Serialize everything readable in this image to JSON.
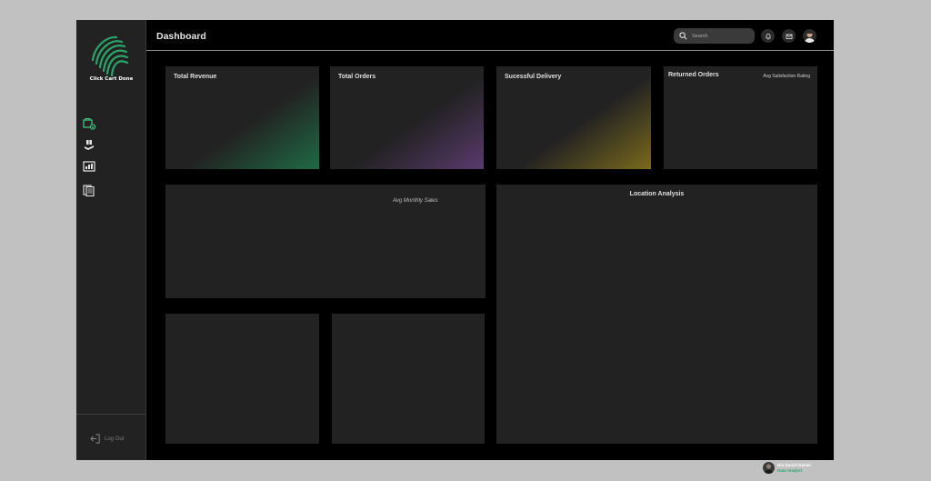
{
  "brand": {
    "name": "Click Cart Done",
    "accent": "#2aa56a"
  },
  "sidebar": {
    "items": [
      {
        "name": "orders-nav",
        "icon": "cart-check-icon"
      },
      {
        "name": "delivery-nav",
        "icon": "delivery-hand-icon"
      },
      {
        "name": "analytics-nav",
        "icon": "chart-board-icon"
      },
      {
        "name": "reports-nav",
        "icon": "documents-icon"
      }
    ],
    "logout_label": "Log Out"
  },
  "header": {
    "title": "Dashboard",
    "search_placeholder": "Search",
    "icons": [
      "bell-icon",
      "mail-icon",
      "avatar"
    ]
  },
  "cards": {
    "total_revenue": {
      "title": "Total Revenue",
      "glow_color": "#1f6b45"
    },
    "total_orders": {
      "title": "Total Orders",
      "glow_color": "#5a3a6e"
    },
    "successful_delivery": {
      "title": "Sucessful Delivery",
      "glow_color": "#7a6a1c"
    },
    "returned_orders": {
      "title": "Returned Orders",
      "subtitle": "Avg Satisfaction Rating"
    }
  },
  "panels": {
    "monthly_sales": {
      "label": "Avg Monthly Sales"
    },
    "location_analysis": {
      "title": "Location Analysis"
    }
  },
  "profile": {
    "name": "Nio Daniel Daniel",
    "role": "Data Analyst"
  }
}
